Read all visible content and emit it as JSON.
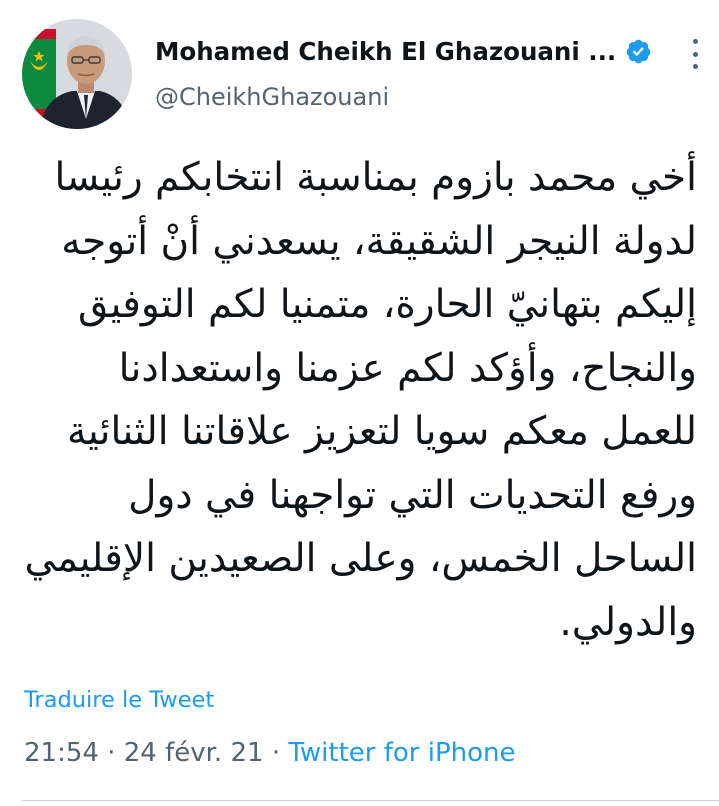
{
  "author": {
    "display_name": "Mohamed Cheikh El Ghazouani ...",
    "handle": "@CheikhGhazouani",
    "avatar_icon": "profile-photo",
    "verified_icon": "verified-badge-icon",
    "verified_color": "#1d9bf0"
  },
  "menu": {
    "icon": "more-vertical-icon"
  },
  "tweet": {
    "lines": [
      "أخي محمد بازوم بمناسبة انتخابكم رئيسا",
      "لدولة النيجر الشقيقة، يسعدني أنْ أتوجه",
      "إليكم بتهانيّ الحارة، متمنيا لكم التوفيق",
      "والنجاح، وأؤكد لكم عزمنا واستعدادنا",
      "للعمل معكم سويا لتعزيز  علاقاتنا الثنائية",
      "ورفع التحديات التي تواجهنا في دول",
      "الساحل الخمس،  وعلى الصعيدين الإقليمي",
      "والدولي."
    ],
    "translate_label": "Traduire le Tweet"
  },
  "meta": {
    "time": "21:54",
    "separator": "·",
    "date": "24 févr. 21",
    "source": "Twitter for iPhone"
  },
  "colors": {
    "link": "#1d9bf0",
    "secondary_text": "#536471",
    "primary_text": "#0f1419"
  }
}
